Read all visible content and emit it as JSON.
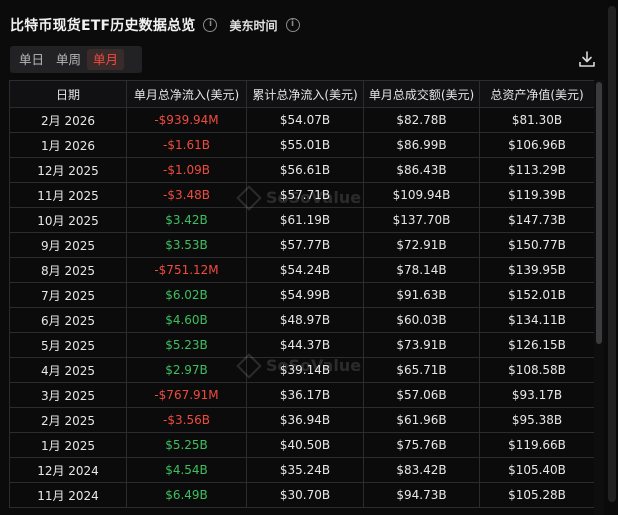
{
  "header": {
    "title": "比特币现货ETF历史数据总览",
    "info_glyph": "i",
    "timezone_label": "美东时间"
  },
  "tabs": [
    {
      "label": "单日",
      "active": false
    },
    {
      "label": "单周",
      "active": false
    },
    {
      "label": "单月",
      "active": true
    }
  ],
  "icons": {
    "download": "download-icon",
    "info": "info-icon"
  },
  "watermark": "SoSoValue",
  "colors": {
    "accent": "#ef4a3f",
    "negative": "#ef4b3f",
    "positive": "#3fbf5f",
    "background": "#0b0b0c"
  },
  "table": {
    "columns": [
      "日期",
      "单月总净流入(美元)",
      "累计总净流入(美元)",
      "单月总成交额(美元)",
      "总资产净值(美元)"
    ],
    "rows": [
      {
        "date": "2月 2026",
        "net_inflow": "-$939.94M",
        "sign": "neg",
        "cumulative": "$54.07B",
        "volume": "$82.78B",
        "nav": "$81.30B"
      },
      {
        "date": "1月 2026",
        "net_inflow": "-$1.61B",
        "sign": "neg",
        "cumulative": "$55.01B",
        "volume": "$86.99B",
        "nav": "$106.96B"
      },
      {
        "date": "12月 2025",
        "net_inflow": "-$1.09B",
        "sign": "neg",
        "cumulative": "$56.61B",
        "volume": "$86.43B",
        "nav": "$113.29B"
      },
      {
        "date": "11月 2025",
        "net_inflow": "-$3.48B",
        "sign": "neg",
        "cumulative": "$57.71B",
        "volume": "$109.94B",
        "nav": "$119.39B"
      },
      {
        "date": "10月 2025",
        "net_inflow": "$3.42B",
        "sign": "pos",
        "cumulative": "$61.19B",
        "volume": "$137.70B",
        "nav": "$147.73B"
      },
      {
        "date": "9月 2025",
        "net_inflow": "$3.53B",
        "sign": "pos",
        "cumulative": "$57.77B",
        "volume": "$72.91B",
        "nav": "$150.77B"
      },
      {
        "date": "8月 2025",
        "net_inflow": "-$751.12M",
        "sign": "neg",
        "cumulative": "$54.24B",
        "volume": "$78.14B",
        "nav": "$139.95B"
      },
      {
        "date": "7月 2025",
        "net_inflow": "$6.02B",
        "sign": "pos",
        "cumulative": "$54.99B",
        "volume": "$91.63B",
        "nav": "$152.01B"
      },
      {
        "date": "6月 2025",
        "net_inflow": "$4.60B",
        "sign": "pos",
        "cumulative": "$48.97B",
        "volume": "$60.03B",
        "nav": "$134.11B"
      },
      {
        "date": "5月 2025",
        "net_inflow": "$5.23B",
        "sign": "pos",
        "cumulative": "$44.37B",
        "volume": "$73.91B",
        "nav": "$126.15B"
      },
      {
        "date": "4月 2025",
        "net_inflow": "$2.97B",
        "sign": "pos",
        "cumulative": "$39.14B",
        "volume": "$65.71B",
        "nav": "$108.58B"
      },
      {
        "date": "3月 2025",
        "net_inflow": "-$767.91M",
        "sign": "neg",
        "cumulative": "$36.17B",
        "volume": "$57.06B",
        "nav": "$93.17B"
      },
      {
        "date": "2月 2025",
        "net_inflow": "-$3.56B",
        "sign": "neg",
        "cumulative": "$36.94B",
        "volume": "$61.96B",
        "nav": "$95.38B"
      },
      {
        "date": "1月 2025",
        "net_inflow": "$5.25B",
        "sign": "pos",
        "cumulative": "$40.50B",
        "volume": "$75.76B",
        "nav": "$119.66B"
      },
      {
        "date": "12月 2024",
        "net_inflow": "$4.54B",
        "sign": "pos",
        "cumulative": "$35.24B",
        "volume": "$83.42B",
        "nav": "$105.40B"
      },
      {
        "date": "11月 2024",
        "net_inflow": "$6.49B",
        "sign": "pos",
        "cumulative": "$30.70B",
        "volume": "$94.73B",
        "nav": "$105.28B"
      }
    ]
  }
}
